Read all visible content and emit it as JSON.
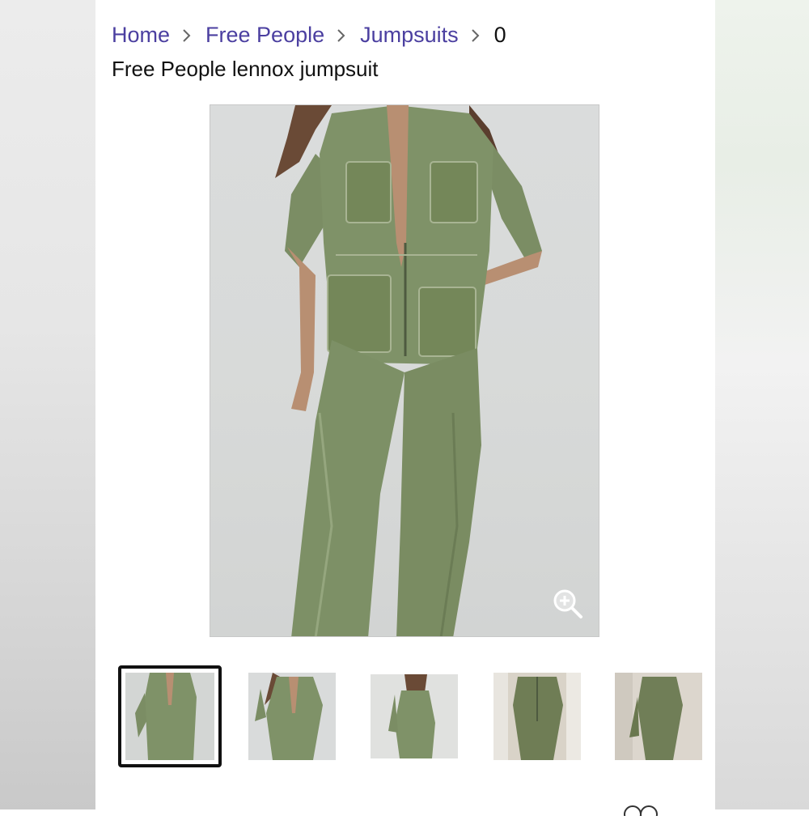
{
  "breadcrumb": {
    "items": [
      {
        "label": "Home"
      },
      {
        "label": "Free People"
      },
      {
        "label": "Jumpsuits"
      }
    ],
    "current": "0"
  },
  "product": {
    "title": "Free People lennox jumpsuit"
  },
  "colors": {
    "link": "#4b3fa0",
    "text": "#111111",
    "jumpsuit_green": "#7f9268",
    "background_gray": "#d8dad9"
  },
  "gallery": {
    "zoom_icon": "zoom-in-icon",
    "thumbnails": [
      {
        "name": "thumbnail-1",
        "selected": true
      },
      {
        "name": "thumbnail-2",
        "selected": false
      },
      {
        "name": "thumbnail-3",
        "selected": false
      },
      {
        "name": "thumbnail-4",
        "selected": false
      },
      {
        "name": "thumbnail-5",
        "selected": false
      }
    ]
  }
}
